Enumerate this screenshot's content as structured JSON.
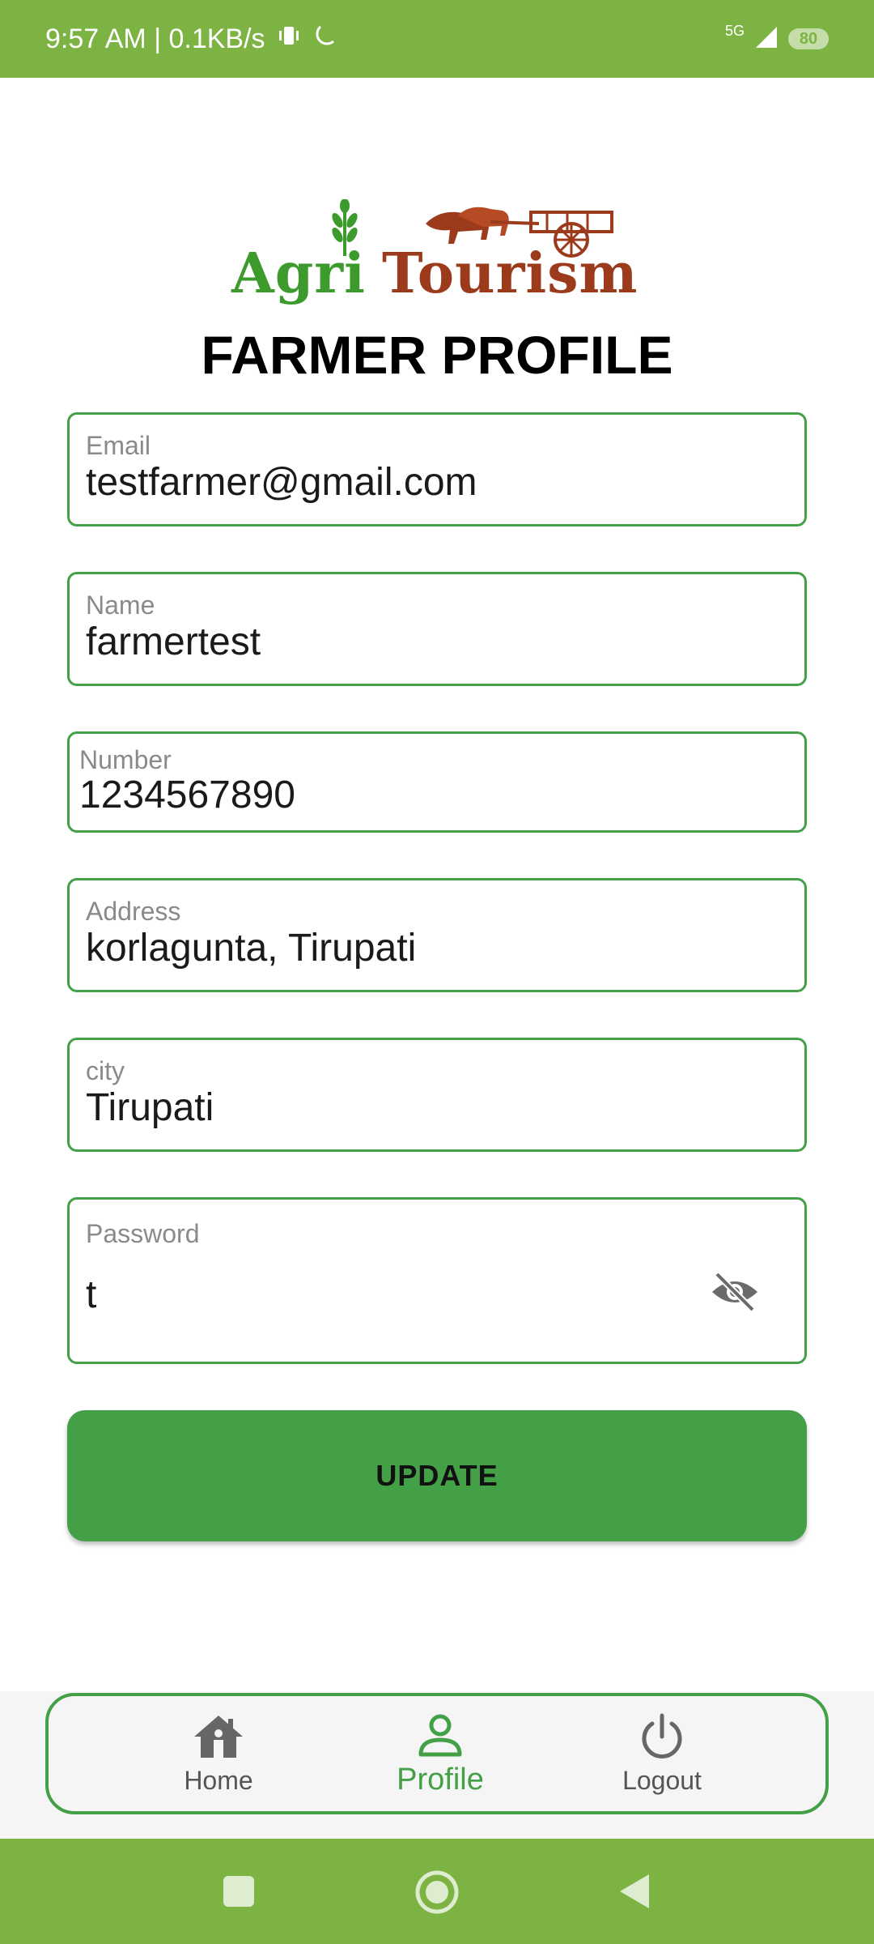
{
  "status_bar": {
    "time_speed": "9:57 AM | 0.1KB/s",
    "network": "5G",
    "battery": "80"
  },
  "logo": {
    "brand_left": "Agri",
    "brand_right": "Tourism"
  },
  "page": {
    "title": "FARMER PROFILE"
  },
  "form": {
    "email": {
      "label": "Email",
      "value": "testfarmer@gmail.com"
    },
    "name": {
      "label": "Name",
      "value": "farmertest"
    },
    "number": {
      "label": "Number",
      "value": "1234567890"
    },
    "address": {
      "label": "Address",
      "value": "korlagunta, Tirupati"
    },
    "city": {
      "label": "city",
      "value": "Tirupati"
    },
    "password": {
      "label": "Password",
      "value": "t"
    },
    "update_label": "UPDATE"
  },
  "bottom_nav": {
    "items": [
      {
        "label": "Home",
        "icon": "home-icon"
      },
      {
        "label": "Profile",
        "icon": "person-icon",
        "active": true
      },
      {
        "label": "Logout",
        "icon": "power-icon"
      }
    ]
  },
  "colors": {
    "primary_green": "#43a047",
    "status_bar_green": "#7cb342",
    "brand_brown": "#9b3b1c"
  }
}
